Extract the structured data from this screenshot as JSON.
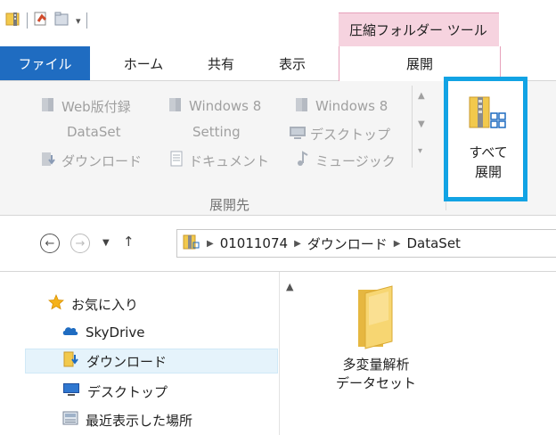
{
  "window": {
    "context_tab_title": "圧縮フォルダー ツール"
  },
  "tabs": {
    "file": "ファイル",
    "home": "ホーム",
    "share": "共有",
    "view": "表示",
    "extract": "展開"
  },
  "ribbon": {
    "destinations": [
      {
        "label": "Web版付録",
        "icon": "folder-icon"
      },
      {
        "label": "Windows 8",
        "icon": "folder-icon"
      },
      {
        "label": "Windows 8",
        "icon": "folder-icon"
      },
      {
        "label": "DataSet",
        "icon": ""
      },
      {
        "label": "Setting",
        "icon": ""
      },
      {
        "label": "デスクトップ",
        "icon": "desktop-icon"
      },
      {
        "label": "ダウンロード",
        "icon": "download-folder-icon"
      },
      {
        "label": "ドキュメント",
        "icon": "document-icon"
      },
      {
        "label": "ミュージック",
        "icon": "music-icon"
      }
    ],
    "group_label": "展開先",
    "extract_all_line1": "すべて",
    "extract_all_line2": "展開"
  },
  "address": {
    "breadcrumb": [
      "01011074",
      "ダウンロード",
      "DataSet"
    ]
  },
  "navigation": {
    "items": [
      {
        "label": "お気に入り",
        "icon": "star-icon"
      },
      {
        "label": "SkyDrive",
        "icon": "skydrive-icon"
      },
      {
        "label": "ダウンロード",
        "icon": "download-folder-icon",
        "selected": true
      },
      {
        "label": "デスクトップ",
        "icon": "desktop-icon"
      },
      {
        "label": "最近表示した場所",
        "icon": "recent-places-icon"
      }
    ]
  },
  "files": [
    {
      "name_line1": "多変量解析",
      "name_line2": "データセット",
      "icon": "folder-icon"
    }
  ],
  "colors": {
    "file_tab": "#1f6cc1",
    "context_tab": "#f6d3df",
    "highlight_border": "#12a3e4",
    "folder": "#f2c94c"
  }
}
